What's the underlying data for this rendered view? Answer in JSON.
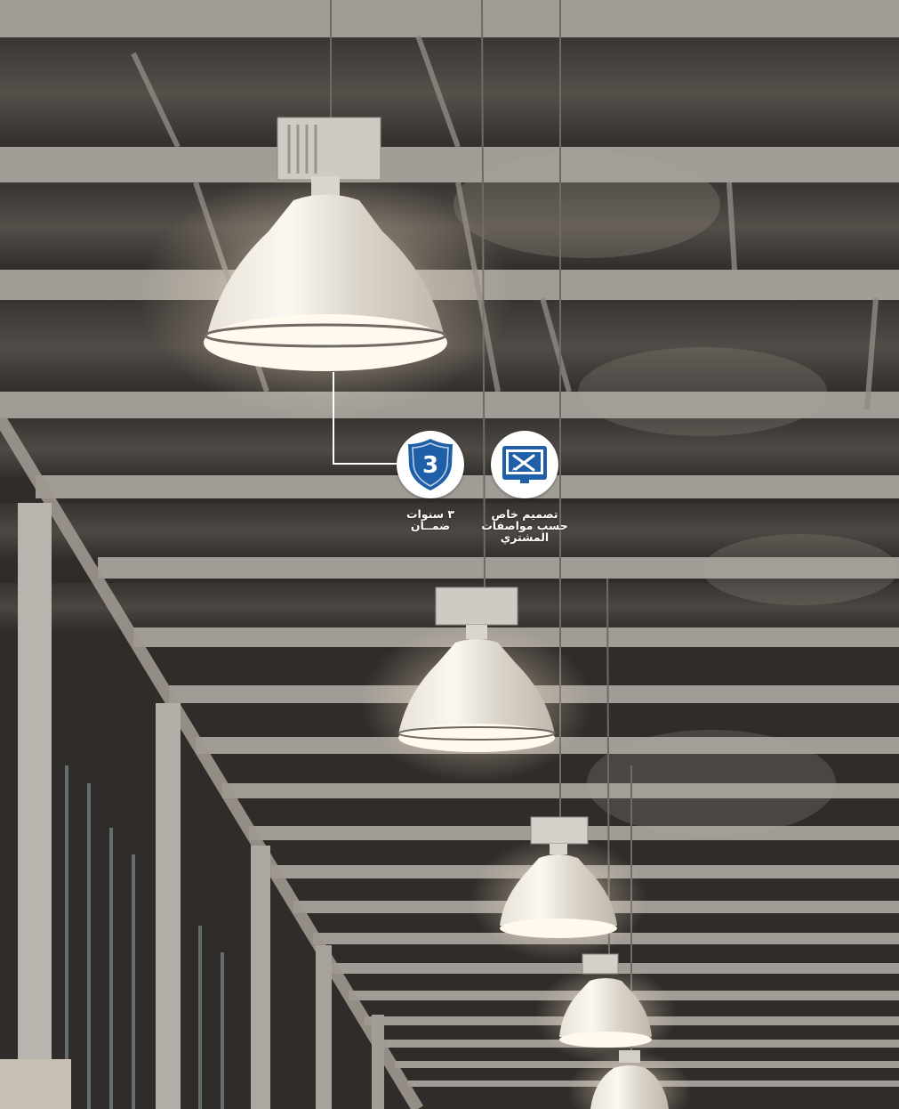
{
  "features": [
    {
      "icon": "warranty-shield-icon",
      "shield_number": "3",
      "caption_lines": [
        "٣ سنوات",
        "ضمــان"
      ]
    },
    {
      "icon": "custom-design-icon",
      "caption_lines": [
        "تصميم خاص",
        "حسب مواصفات",
        "المشتري"
      ]
    }
  ],
  "colors": {
    "badge_blue": "#1f5fa8",
    "badge_background": "#ffffff",
    "ceiling": "#2f2c2a",
    "beam": "#a39e98"
  }
}
